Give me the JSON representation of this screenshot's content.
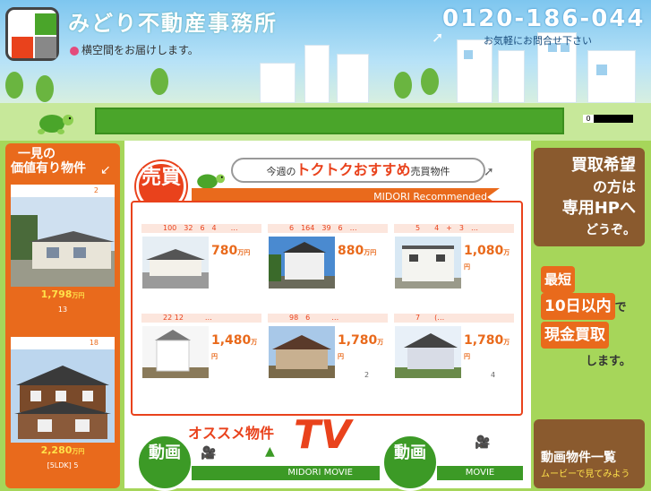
{
  "header": {
    "site_title": "みどり不動産事務所",
    "tagline": "横空間をお届けします。",
    "phone": "0120-186-044",
    "phone_note": "お気軽にお問合せ下さい"
  },
  "navbar": {
    "badge": "0"
  },
  "left": {
    "title_line1": "一見の",
    "title_line2": "価値有り物件",
    "cards": [
      {
        "head": "2",
        "price": "1,798",
        "unit": "万円",
        "foot": "13"
      },
      {
        "head": "18",
        "price": "2,280",
        "unit": "万円",
        "foot": "[5LDK] 5"
      }
    ]
  },
  "recommend": {
    "badge": "売買",
    "title_pre": "今週の",
    "title_main": "トクトクおすすめ",
    "title_post": "売買物件",
    "ribbon": "MIDORI Recommended",
    "listings": [
      {
        "head": "100　32　6　4　　…",
        "price": "780",
        "unit": "万円",
        "page": ""
      },
      {
        "head": "6　164　39　6　…",
        "price": "880",
        "unit": "万円",
        "page": ""
      },
      {
        "head": "5　　4　+　3　…",
        "price": "1,080",
        "unit": "万円",
        "page": ""
      },
      {
        "head": "22 12　　　…",
        "price": "1,480",
        "unit": "万円",
        "page": ""
      },
      {
        "head": "98　6　　　…",
        "price": "1,780",
        "unit": "万円",
        "page": "2"
      },
      {
        "head": "7　　(…",
        "price": "1,780",
        "unit": "万円",
        "page": "4"
      }
    ]
  },
  "tv": {
    "badge": "動画",
    "title": "オススメ物件",
    "big": "TV",
    "ribbon": "MIDORI MOVIE",
    "badge2": "動画",
    "ribbon2": "MOVIE"
  },
  "right": {
    "wood1_l1": "買取希望",
    "wood1_l2": "の方は",
    "wood1_l3": "専用HPへ",
    "wood1_l4": "どうぞ。",
    "cash_l1": "最短",
    "cash_l2": "10日以内",
    "cash_l2b": "で",
    "cash_l3": "現金買取",
    "cash_l4": "します。",
    "video_l1": "動画物件一覧",
    "video_l2": "ムービーで見てみよう"
  }
}
